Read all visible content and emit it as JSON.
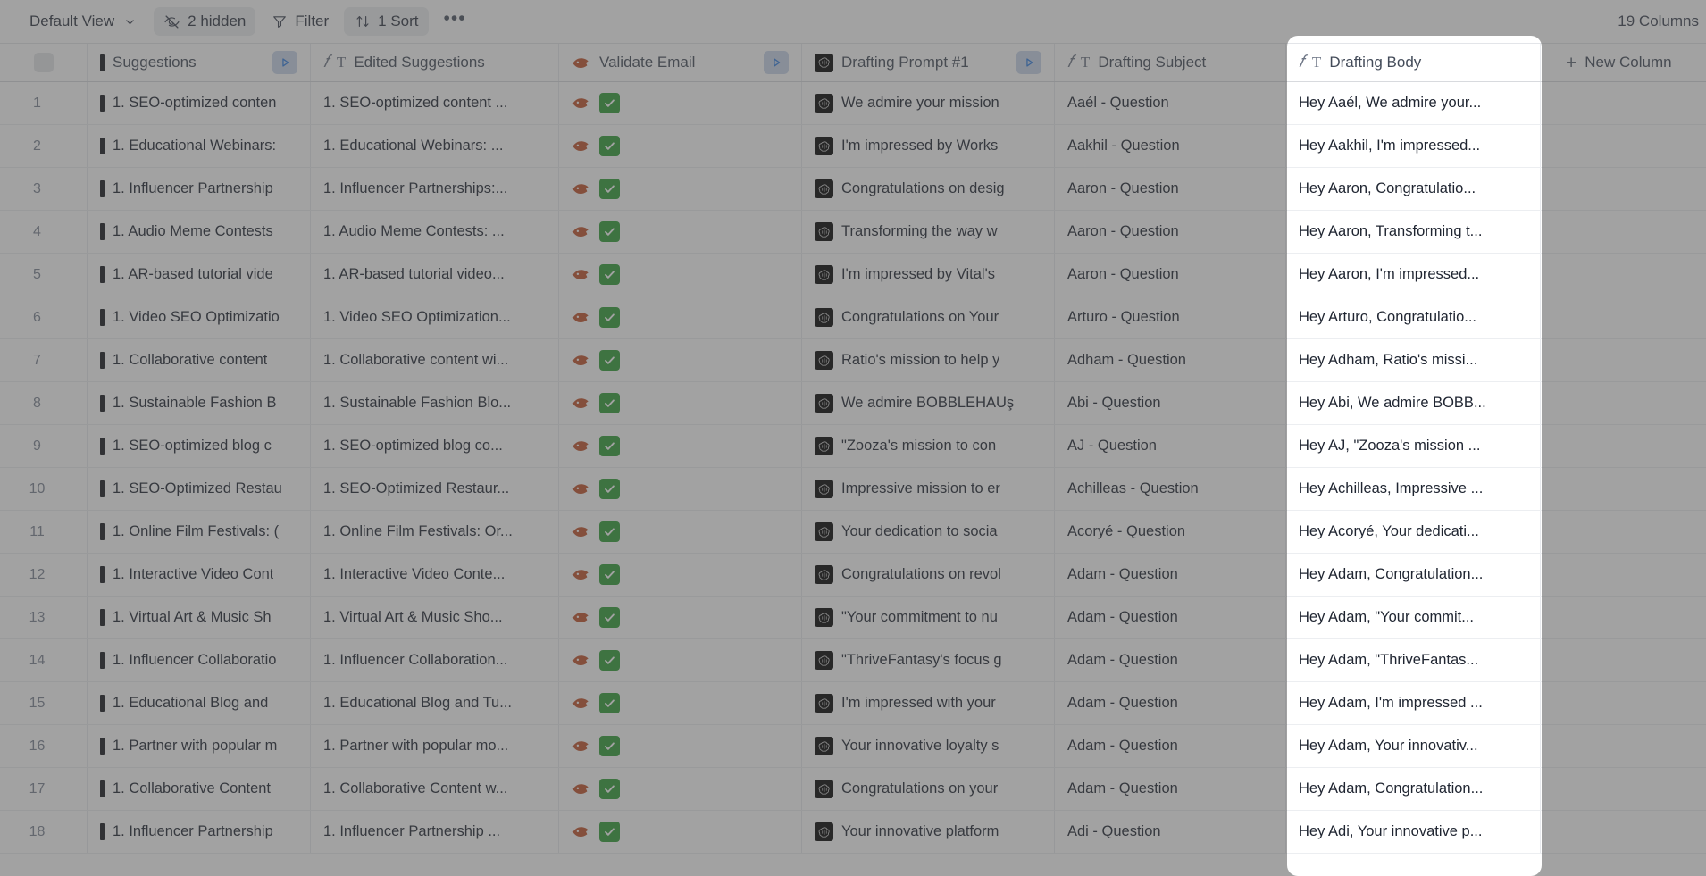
{
  "toolbar": {
    "view_label": "Default View",
    "view_caret_icon": "chevron-down-icon",
    "hidden_label": "2 hidden",
    "hidden_icon": "eye-off-icon",
    "filter_label": "Filter",
    "filter_icon": "funnel-icon",
    "sort_label": "1 Sort",
    "sort_icon": "sort-arrows-icon",
    "more_label": "•••",
    "column_count_label": "19 Columns"
  },
  "grid": {
    "select_all_name": "select-all-checkbox",
    "new_column_label": "New Column",
    "new_column_plus": "+",
    "columns": [
      {
        "key": "suggestions",
        "label": "Suggestions",
        "fx": false,
        "type_icon": "none",
        "run_button": true
      },
      {
        "key": "edited_suggestions",
        "label": "Edited Suggestions",
        "fx": true,
        "type_icon": "text-icon",
        "run_button": false
      },
      {
        "key": "validate_email",
        "label": "Validate Email",
        "fx": false,
        "type_icon": "hunter-icon",
        "run_button": true
      },
      {
        "key": "drafting_prompt_1",
        "label": "Drafting Prompt #1",
        "fx": false,
        "type_icon": "openai-icon",
        "run_button": true
      },
      {
        "key": "drafting_subject",
        "label": "Drafting Subject",
        "fx": true,
        "type_icon": "text-icon",
        "run_button": false
      },
      {
        "key": "drafting_body",
        "label": "Drafting Body",
        "fx": true,
        "type_icon": "text-icon",
        "run_button": false
      }
    ],
    "rows": [
      {
        "n": "1",
        "suggestions": "1. SEO-optimized conten",
        "edited": "1. SEO-optimized content ...",
        "validate": "✅",
        "prompt": "We admire your mission",
        "subject": "Aaél - Question",
        "body": "Hey Aaél, We admire your..."
      },
      {
        "n": "2",
        "suggestions": "1. Educational Webinars:",
        "edited": "1. Educational Webinars: ...",
        "validate": "✅",
        "prompt": "I'm impressed by Works",
        "subject": "Aakhil - Question",
        "body": "Hey Aakhil, I'm impressed..."
      },
      {
        "n": "3",
        "suggestions": "1. Influencer Partnership",
        "edited": "1. Influencer Partnerships:...",
        "validate": "✅",
        "prompt": "Congratulations on desiɡ",
        "subject": "Aaron - Question",
        "body": "Hey Aaron, Congratulatio..."
      },
      {
        "n": "4",
        "suggestions": "1. Audio Meme Contests",
        "edited": "1. Audio Meme Contests: ...",
        "validate": "✅",
        "prompt": "Transforming the way w",
        "subject": "Aaron - Question",
        "body": "Hey Aaron, Transforming t..."
      },
      {
        "n": "5",
        "suggestions": "1. AR-based tutorial vide",
        "edited": "1. AR-based tutorial video...",
        "validate": "✅",
        "prompt": "I'm impressed by Vital's",
        "subject": "Aaron - Question",
        "body": "Hey Aaron, I'm impressed..."
      },
      {
        "n": "6",
        "suggestions": "1. Video SEO Optimizatio",
        "edited": "1. Video SEO Optimization...",
        "validate": "✅",
        "prompt": "Congratulations on Your",
        "subject": "Arturo - Question",
        "body": "Hey Arturo, Congratulatio..."
      },
      {
        "n": "7",
        "suggestions": "1. Collaborative content",
        "edited": "1. Collaborative content wi...",
        "validate": "✅",
        "prompt": "Ratio's mission to help y",
        "subject": "Adham - Question",
        "body": "Hey Adham, Ratio's missi..."
      },
      {
        "n": "8",
        "suggestions": "1. Sustainable Fashion B",
        "edited": "1. Sustainable Fashion Blo...",
        "validate": "✅",
        "prompt": "We admire BOBBLEHAUş",
        "subject": "Abi - Question",
        "body": "Hey Abi, We admire BOBB..."
      },
      {
        "n": "9",
        "suggestions": "1. SEO-optimized blog c",
        "edited": "1. SEO-optimized blog co...",
        "validate": "✅",
        "prompt": "\"Zooza's mission to con",
        "subject": "AJ - Question",
        "body": "Hey AJ, \"Zooza's mission ..."
      },
      {
        "n": "10",
        "suggestions": "1. SEO-Optimized Restau",
        "edited": "1. SEO-Optimized Restaur...",
        "validate": "✅",
        "prompt": "Impressive mission to er",
        "subject": "Achilleas - Question",
        "body": "Hey Achilleas, Impressive ..."
      },
      {
        "n": "11",
        "suggestions": "1. Online Film Festivals: (",
        "edited": "1. Online Film Festivals: Or...",
        "validate": "✅",
        "prompt": "Your dedication to socia",
        "subject": "Acoryé - Question",
        "body": "Hey Acoryé, Your dedicati..."
      },
      {
        "n": "12",
        "suggestions": "1. Interactive Video Cont",
        "edited": "1. Interactive Video Conte...",
        "validate": "✅",
        "prompt": "Congratulations on revol",
        "subject": "Adam - Question",
        "body": "Hey Adam, Congratulation..."
      },
      {
        "n": "13",
        "suggestions": "1. Virtual Art & Music Sh",
        "edited": "1. Virtual Art & Music Sho...",
        "validate": "✅",
        "prompt": "\"Your commitment to nu",
        "subject": "Adam - Question",
        "body": "Hey Adam, \"Your commit..."
      },
      {
        "n": "14",
        "suggestions": "1. Influencer Collaboratio",
        "edited": "1. Influencer Collaboration...",
        "validate": "✅",
        "prompt": "\"ThriveFantasy's focus ɡ",
        "subject": "Adam - Question",
        "body": "Hey Adam, \"ThriveFantas..."
      },
      {
        "n": "15",
        "suggestions": "1. Educational Blog and ",
        "edited": "1. Educational Blog and Tu...",
        "validate": "✅",
        "prompt": "I'm impressed with your",
        "subject": "Adam - Question",
        "body": "Hey Adam, I'm impressed ..."
      },
      {
        "n": "16",
        "suggestions": "1. Partner with popular m",
        "edited": "1. Partner with popular mo...",
        "validate": "✅",
        "prompt": "Your innovative loyalty s",
        "subject": "Adam - Question",
        "body": "Hey Adam, Your innovativ..."
      },
      {
        "n": "17",
        "suggestions": "1. Collaborative Content",
        "edited": "1. Collaborative Content w...",
        "validate": "✅",
        "prompt": "Congratulations on your",
        "subject": "Adam - Question",
        "body": "Hey Adam, Congratulation..."
      },
      {
        "n": "18",
        "suggestions": "1. Influencer Partnership",
        "edited": "1. Influencer Partnership ...",
        "validate": "✅",
        "prompt": "Your innovative platform",
        "subject": "Adi - Question",
        "body": "Hey Adi, Your innovative p..."
      }
    ]
  },
  "colors": {
    "accent_play": "#2f7ce0",
    "hunter_orange": "#c0522a",
    "check_green": "#2f9e36",
    "dim_overlay": "#4d4d4d"
  }
}
